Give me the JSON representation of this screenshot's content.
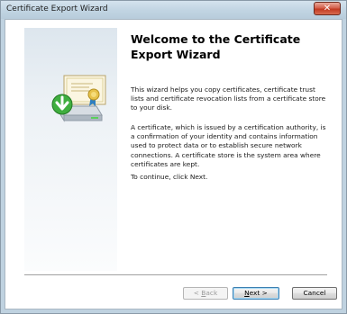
{
  "window": {
    "title": "Certificate Export Wizard",
    "close_glyph": "✕"
  },
  "icons": {
    "close": "close-icon",
    "wizard": "certificate-export-icon"
  },
  "content": {
    "heading": "Welcome to the Certificate Export Wizard",
    "paragraph1": "This wizard helps you copy certificates, certificate trust lists and certificate revocation lists from a certificate store to your disk.",
    "paragraph2": "A certificate, which is issued by a certification authority, is a confirmation of your identity and contains information used to protect data or to establish secure network connections. A certificate store is the system area where certificates are kept.",
    "paragraph3": "To continue, click Next."
  },
  "buttons": {
    "back": {
      "prefix": "< ",
      "mnemonic": "B",
      "rest": "ack",
      "enabled": false
    },
    "next": {
      "prefix": "",
      "mnemonic": "N",
      "rest": "ext >",
      "enabled": true,
      "default": true
    },
    "cancel": {
      "label": "Cancel",
      "enabled": true
    }
  },
  "colors": {
    "title_bar": "#c2d5e3",
    "close_button": "#c23a22",
    "default_button_border": "#3c7fb1",
    "disabled_text": "#9a9a9a"
  }
}
